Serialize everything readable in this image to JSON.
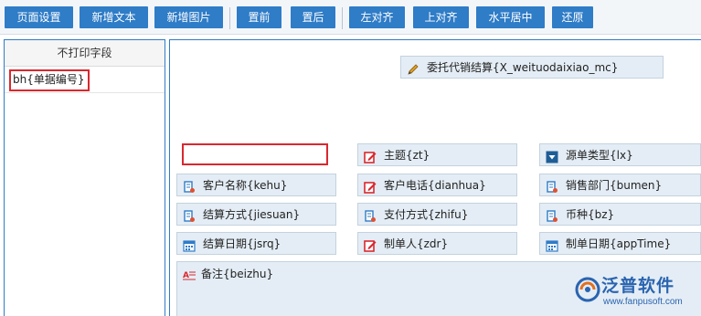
{
  "toolbar": {
    "page_settings": "页面设置",
    "add_text": "新增文本",
    "add_image": "新增图片",
    "bring_front": "置前",
    "send_back": "置后",
    "align_left": "左对齐",
    "align_top": "上对齐",
    "center_horizontal": "水平居中",
    "restore": "还原"
  },
  "left_panel": {
    "header": "不打印字段",
    "items": [
      {
        "label": "bh{单据编号}"
      }
    ]
  },
  "fields": {
    "title": "委托代销结算{X_weituodaixiao_mc}",
    "theme": "主题{zt}",
    "source_type": "源单类型{lx}",
    "customer_name": "客户名称{kehu}",
    "customer_phone": "客户电话{dianhua}",
    "sales_dept": "销售部门{bumen}",
    "settle_method": "结算方式{jiesuan}",
    "pay_method": "支付方式{zhifu}",
    "currency": "币种{bz}",
    "settle_date": "结算日期{jsrq}",
    "creator": "制单人{zdr}",
    "create_date": "制单日期{appTime}",
    "remark": "备注{beizhu}"
  },
  "logo": {
    "name": "泛普软件",
    "url": "www.fanpusoft.com"
  },
  "colors": {
    "accent": "#2f7cc7",
    "highlight": "#d9282f",
    "field_bg": "#e4edf5"
  }
}
